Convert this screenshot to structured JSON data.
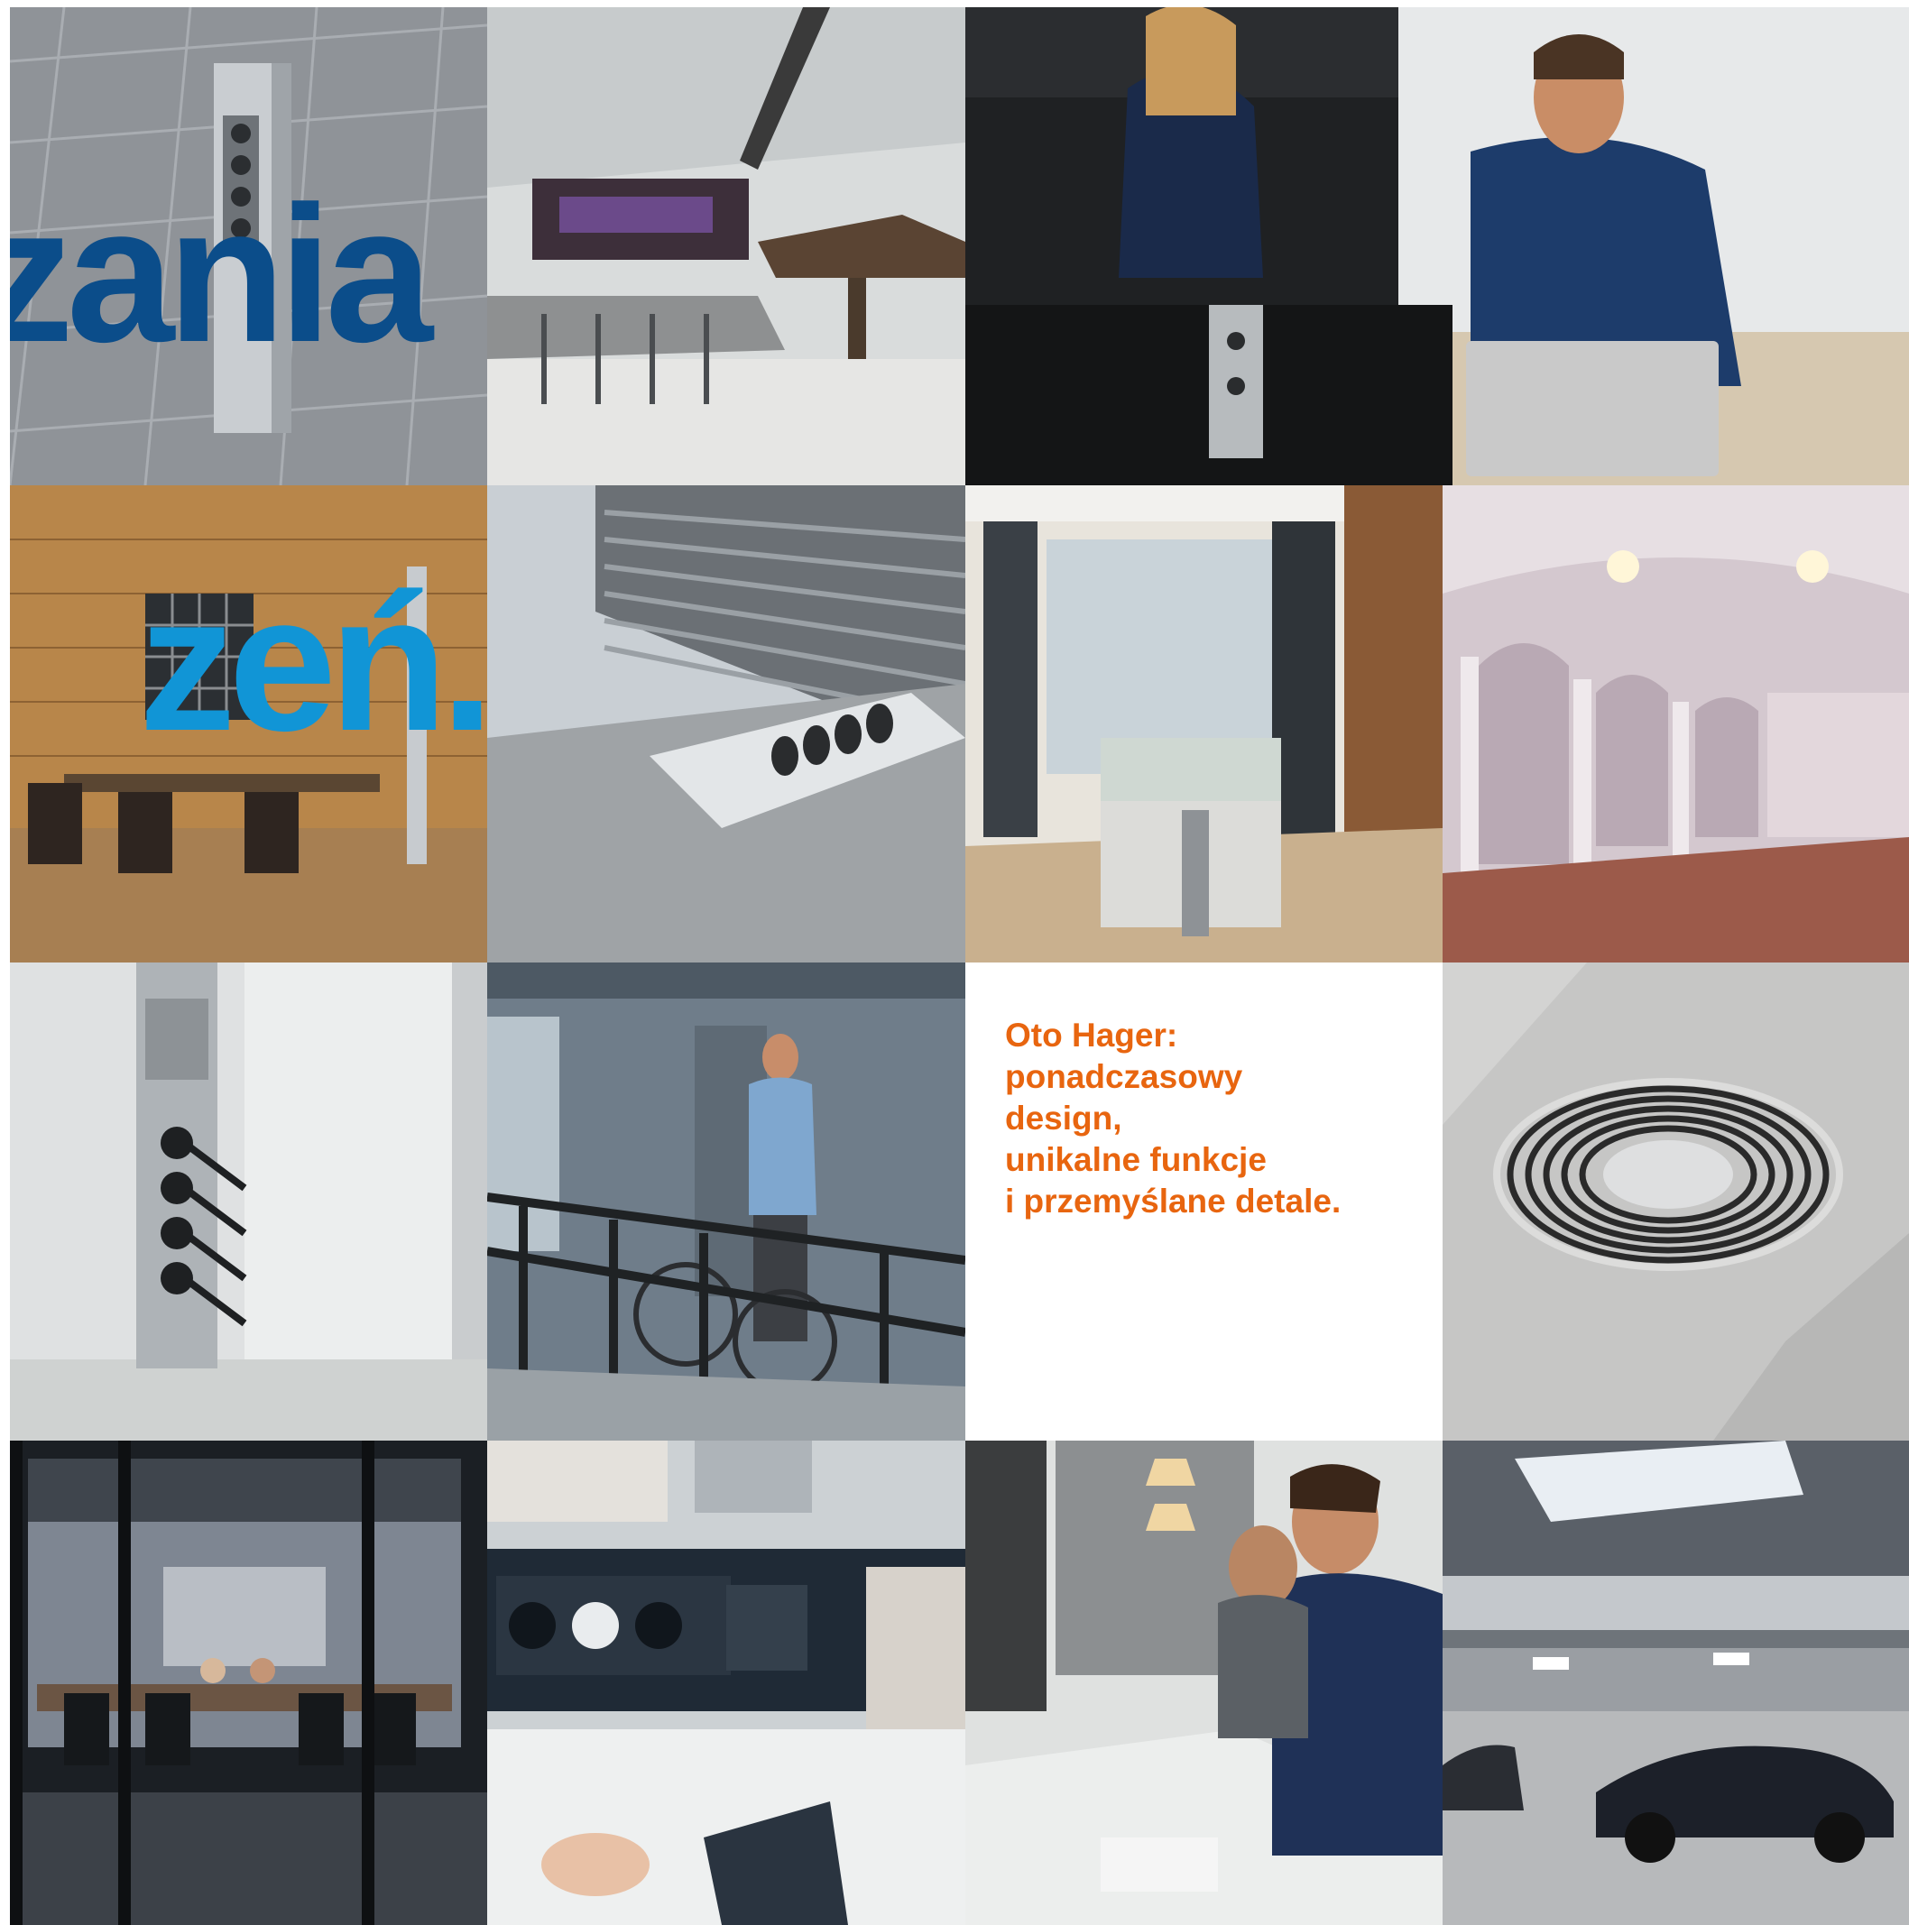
{
  "headline": {
    "line1": "zania",
    "line2": "zeń."
  },
  "tagline": {
    "lines": [
      "Oto Hager:",
      "ponadczasowy",
      "design,",
      "unikalne funkcje",
      "i przemyślane detale."
    ]
  },
  "colors": {
    "headline_dark_blue": "#0b4d8a",
    "headline_light_blue": "#1195d6",
    "tagline_orange": "#e8650f"
  },
  "photos": [
    {
      "row": 1,
      "col": 1,
      "subject": "floor-standing power column on grey tiles"
    },
    {
      "row": 1,
      "col": 2,
      "subject": "modern bar interior"
    },
    {
      "row": 1,
      "col": 3,
      "subject": "two people at counter with pop-up socket"
    },
    {
      "row": 2,
      "col": 1,
      "subject": "brick-wall meeting room with power pole"
    },
    {
      "row": 2,
      "col": 2,
      "subject": "floor trunking with sockets"
    },
    {
      "row": 2,
      "col": 3,
      "subject": "showroom corridor with display table"
    },
    {
      "row": 2,
      "col": 4,
      "subject": "historic hall with chandeliers"
    },
    {
      "row": 3,
      "col": 1,
      "subject": "wall column with plugs"
    },
    {
      "row": 3,
      "col": 2,
      "subject": "man with bicycle on walkway"
    },
    {
      "row": 3,
      "col": 4,
      "subject": "round floor outlet cover"
    },
    {
      "row": 4,
      "col": 1,
      "subject": "glass meeting room at night"
    },
    {
      "row": 4,
      "col": 2,
      "subject": "desk socket strip with charger"
    },
    {
      "row": 4,
      "col": 3,
      "subject": "men writing at long desk"
    },
    {
      "row": 4,
      "col": 4,
      "subject": "car showroom with floor outlets"
    }
  ]
}
